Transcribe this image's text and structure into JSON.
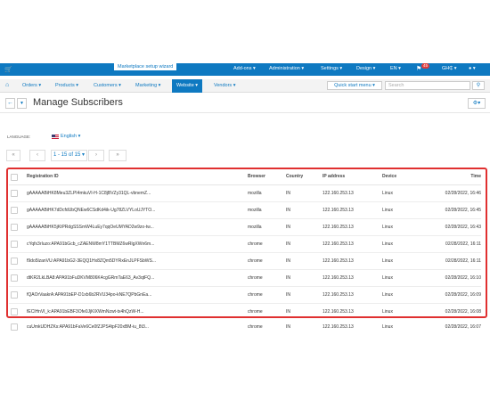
{
  "topbar": {
    "wizard_label": "Marketplace setup wizard",
    "addons": "Add-ons ▾",
    "administration": "Administration ▾",
    "settings": "Settings ▾",
    "design": "Design ▾",
    "language": "EN ▾",
    "notif_count": "45",
    "currency": "GH₵ ▾",
    "user": "▾"
  },
  "nav": {
    "orders": "Orders ▾",
    "products": "Products ▾",
    "customers": "Customers ▾",
    "marketing": "Marketing ▾",
    "website": "Website ▾",
    "vendors": "Vendors ▾",
    "quick_start": "Quick start menu ▾",
    "search_placeholder": "Search"
  },
  "page": {
    "title": "Manage Subscribers",
    "language_label": "LANGUAGE:",
    "language_value": "English ▾"
  },
  "pager": {
    "first": "«",
    "prev": "‹",
    "range": "1 - 15 of 15 ▾",
    "next": "›",
    "last": "»"
  },
  "table": {
    "headers": {
      "id": "Registration ID",
      "browser": "Browser",
      "country": "Country",
      "ip": "IP address",
      "device": "Device",
      "time": "Time"
    },
    "rows": [
      {
        "id": "gAAAAABiHK8Meu3ZLPI4mkuVI-H-1C8jBVZy31QL-vbnemZ...",
        "browser": "mozilla",
        "country": "IN",
        "ip": "122.160.253.13",
        "device": "Linux",
        "time": "02/28/2022, 16:46"
      },
      {
        "id": "gAAAAABiHK7dDcfdUbQNEw6CSdKd4ik-Ug78ZLVYLoUJYTO...",
        "browser": "mozilla",
        "country": "IN",
        "ip": "122.160.253.13",
        "device": "Linux",
        "time": "02/28/2022, 16:45"
      },
      {
        "id": "gAAAAABiHK5jKtPRdgSSSmW4LuEy7qqOeUMYAD2w9zo-tw...",
        "browser": "mozilla",
        "country": "IN",
        "ip": "122.160.253.13",
        "device": "Linux",
        "time": "02/28/2022, 16:43"
      },
      {
        "id": "cYqfx3rIuzo:APA91bGcb_cZAENW8mY1TTBMZ6wRlgXWn6m...",
        "browser": "chrome",
        "country": "IN",
        "ip": "122.160.253.13",
        "device": "Linux",
        "time": "02/28/2022, 16:11"
      },
      {
        "id": "f9do5lzanVU:APA91bG2-3EQQ1Hx8ZQm5DYRxEnJLPFSbWS...",
        "browser": "chrome",
        "country": "IN",
        "ip": "122.160.253.13",
        "device": "Linux",
        "time": "02/28/2022, 16:11"
      },
      {
        "id": "dtKR2LkLBA8:APA91bFuDKVM806K4cgGRmTaE63_Av3qtFQ...",
        "browser": "chrome",
        "country": "IN",
        "ip": "122.160.253.13",
        "device": "Linux",
        "time": "02/28/2022, 16:10"
      },
      {
        "id": "fQAOrVaakrA:APA91bEP-D1xb6b2RVU34po-kNE7QPbGnEa...",
        "browser": "chrome",
        "country": "IN",
        "ip": "122.160.253.13",
        "device": "Linux",
        "time": "02/28/2022, 16:09"
      },
      {
        "id": "fEClHnVI_k:APA91bEBF3Ofe0JjKlXWmNzwt-tx4hQzW-H...",
        "browser": "chrome",
        "country": "IN",
        "ip": "122.160.253.13",
        "device": "Linux",
        "time": "02/28/2022, 16:08"
      },
      {
        "id": "cuUmkUDHZKs:APA91bFaVe6Ce0fZJPS4tpF20xBM-iu_8t3...",
        "browser": "chrome",
        "country": "IN",
        "ip": "122.160.253.13",
        "device": "Linux",
        "time": "02/28/2022, 16:07"
      }
    ]
  }
}
